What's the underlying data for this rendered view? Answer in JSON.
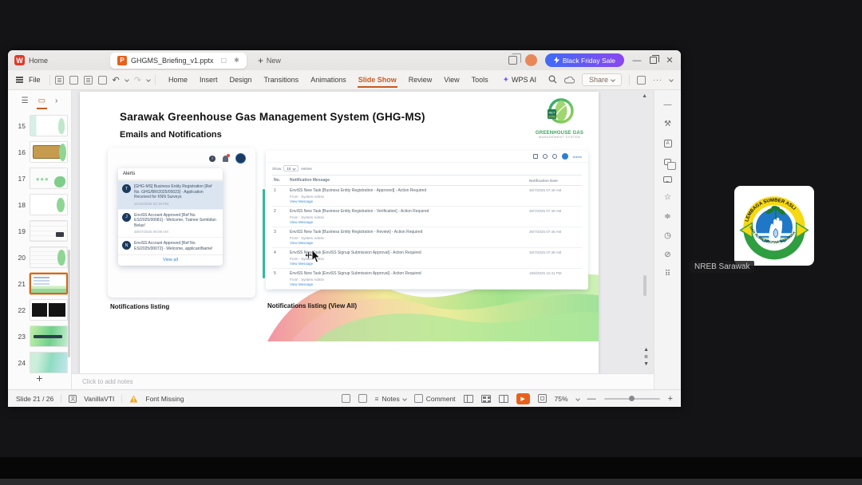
{
  "chrome": {
    "home_tab": "Home",
    "doc_tab": "GHGMS_Briefing_v1.pptx",
    "new_tab": "New",
    "promo": "Black Friday Sale",
    "file": "File",
    "menus": [
      "Home",
      "Insert",
      "Design",
      "Transitions",
      "Animations",
      "Slide Show",
      "Review",
      "View",
      "Tools"
    ],
    "active_menu": "Slide Show",
    "wps_ai": "WPS AI",
    "share": "Share"
  },
  "thumbs": {
    "items": [
      {
        "num": "15",
        "variant": "v15"
      },
      {
        "num": "16",
        "variant": "v16"
      },
      {
        "num": "17",
        "variant": "v17"
      },
      {
        "num": "18",
        "variant": "v18"
      },
      {
        "num": "19",
        "variant": "v19"
      },
      {
        "num": "20",
        "variant": "v20"
      },
      {
        "num": "21",
        "variant": "v21",
        "selected": true
      },
      {
        "num": "22",
        "variant": "v22"
      },
      {
        "num": "23",
        "variant": "v23"
      },
      {
        "num": "24",
        "variant": "v24"
      }
    ]
  },
  "slide": {
    "title": "Sarawak Greenhouse Gas Management System (GHG-MS)",
    "subtitle": "Emails and Notifications",
    "logo": {
      "badge_line1": "NET",
      "badge_line2": "2050",
      "line1": "GREENHOUSE GAS",
      "line2": "MANAGEMENT SYSTEM"
    },
    "alerts": {
      "header": "Alerts",
      "view_all": "View all",
      "items": [
        {
          "avatar": "T",
          "text": "[GHG-MS] Business Entity Registration [Ref No. GHG/BR/2025/00023] - Application Received for KNN Surveys",
          "date": "21/10/2025 02:19 PM",
          "selected": true
        },
        {
          "avatar": "J",
          "text": "EnviSS Account Approved [Ref No. ES/2025/00081] - Welcome, Trainee Sembilan Belas!",
          "date": "30/07/2025 09:09 AM"
        },
        {
          "avatar": "N",
          "text": "EnviSS Account Approved [Ref No. ES/2025/00072] - Welcome, applicantName!",
          "date": ""
        }
      ]
    },
    "portal": {
      "user": "Admin",
      "show": "Show",
      "page_size": "10",
      "entries": "entries",
      "columns": [
        "No.",
        "Notification Message",
        "Notification Date"
      ],
      "rows": [
        {
          "no": "1",
          "message": "EnviSS New Task [Business Entity Registration - Approved] - Action Required",
          "from": "From : System Admin",
          "link": "View Message",
          "date": "30/7/2025 07:49 AM"
        },
        {
          "no": "2",
          "message": "EnviSS New Task [Business Entity Registration - Verification] - Action Required",
          "from": "From : System Admin",
          "link": "View Message",
          "date": "30/7/2025 07:49 AM"
        },
        {
          "no": "3",
          "message": "EnviSS New Task [Business Entity Registration - Review] - Action Required",
          "from": "From : System Admin",
          "link": "View Message",
          "date": "30/7/2025 07:46 AM"
        },
        {
          "no": "4",
          "message": "EnviSS New Task [EnviSS Signup Submission Approval] - Action Required",
          "from": "From : System Admin",
          "link": "View Message",
          "date": "30/7/2025 07:39 AM"
        },
        {
          "no": "5",
          "message": "EnviSS New Task [EnviSS Signup Submission Approval] - Action Required",
          "from": "From : System Admin",
          "link": "View Message",
          "date": "18/6/2025 12:41 PM"
        }
      ]
    },
    "captions": {
      "left": "Notifications listing",
      "right": "Notifications listing (View All)"
    }
  },
  "notes_placeholder": "Click to add notes",
  "statusbar": {
    "slide_indicator": "Slide 21 / 26",
    "language": "VanillaVTI",
    "font_missing": "Font Missing",
    "notes": "Notes",
    "comment": "Comment",
    "zoom_level": "75%"
  },
  "participant": {
    "name": "NREB Sarawak",
    "logo_arc_top": "LEMBAGA SUMBER ASLI",
    "logo_arc_bottom": "DAN ALAM SEKITAR SARAWAK"
  },
  "colors": {
    "accent_orange": "#c85a1e",
    "promo_gradient_from": "#3f6bf5",
    "promo_gradient_to": "#8a46f0",
    "teal": "#2fbfa0",
    "link_blue": "#3f8fdb",
    "alert_navy": "#1c3a5e",
    "play_orange": "#e8611c"
  }
}
